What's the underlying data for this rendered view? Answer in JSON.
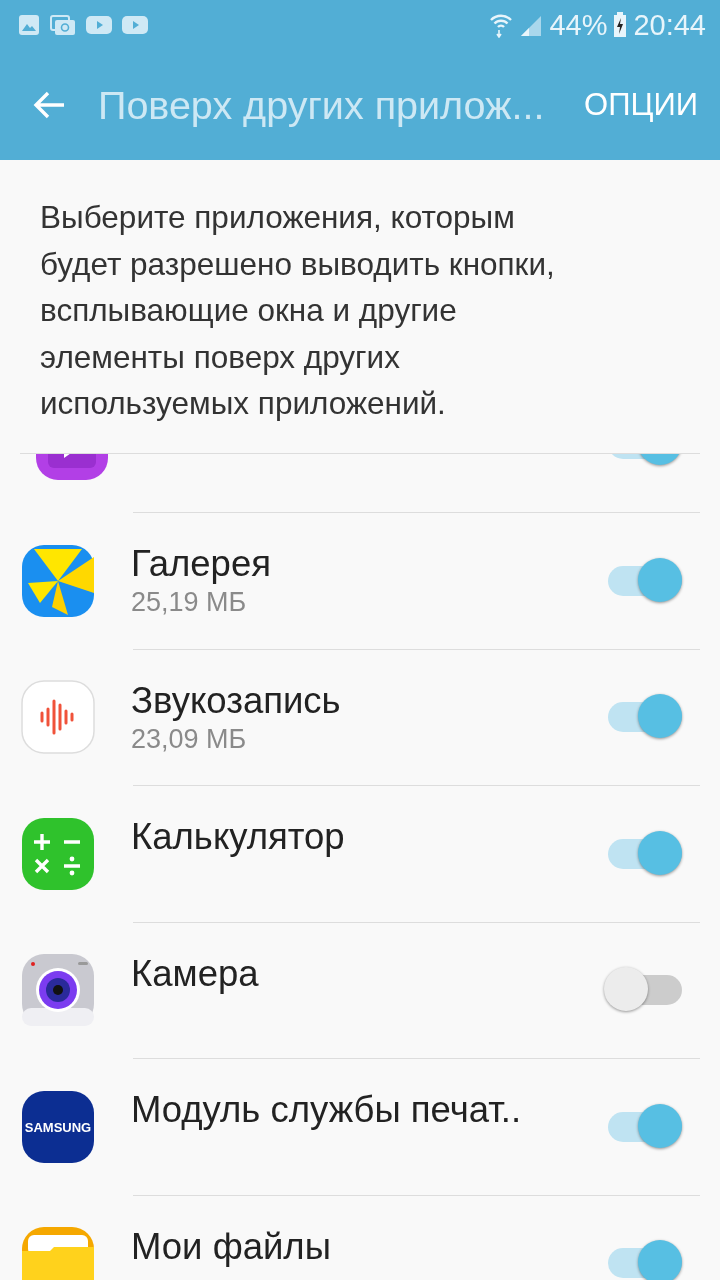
{
  "status_bar": {
    "battery": "44%",
    "time": "20:44"
  },
  "app_bar": {
    "title": "Поверх других прилож...",
    "menu": "ОПЦИИ"
  },
  "description": "Выберите приложения, которым будет разрешено выводить кнопки, всплывающие окна и другие элементы поверх других используемых приложений.",
  "apps": [
    {
      "kind": "video",
      "on": true
    },
    {
      "kind": "gallery",
      "name": "Галерея",
      "size": "25,19 МБ",
      "on": true
    },
    {
      "kind": "recorder",
      "name": "Звукозапись",
      "size": "23,09 МБ",
      "on": true
    },
    {
      "kind": "calculator",
      "name": "Калькулятор",
      "on": true
    },
    {
      "kind": "camera",
      "name": "Камера",
      "on": false
    },
    {
      "kind": "samsung",
      "name": "Модуль службы печат..",
      "icon_text": "SAMSUNG",
      "on": true
    },
    {
      "kind": "files",
      "name": "Мои файлы",
      "on": true
    }
  ]
}
